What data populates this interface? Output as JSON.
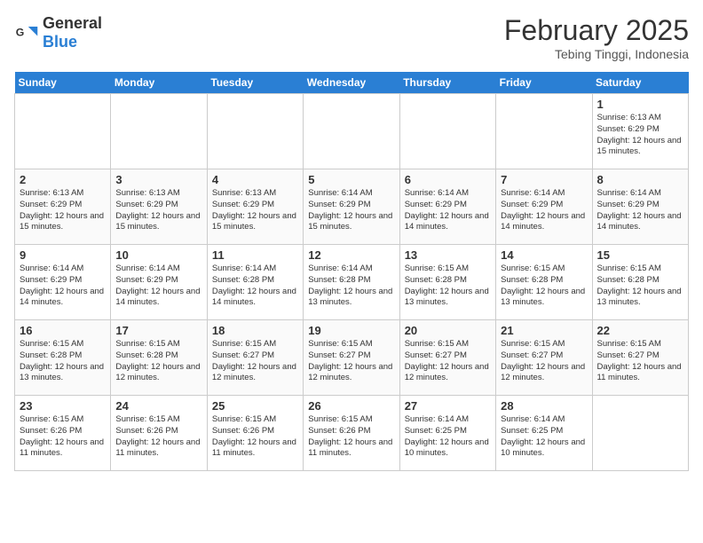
{
  "header": {
    "logo_general": "General",
    "logo_blue": "Blue",
    "month_year": "February 2025",
    "location": "Tebing Tinggi, Indonesia"
  },
  "days_of_week": [
    "Sunday",
    "Monday",
    "Tuesday",
    "Wednesday",
    "Thursday",
    "Friday",
    "Saturday"
  ],
  "weeks": [
    [
      {
        "day": "",
        "content": ""
      },
      {
        "day": "",
        "content": ""
      },
      {
        "day": "",
        "content": ""
      },
      {
        "day": "",
        "content": ""
      },
      {
        "day": "",
        "content": ""
      },
      {
        "day": "",
        "content": ""
      },
      {
        "day": "1",
        "content": "Sunrise: 6:13 AM\nSunset: 6:29 PM\nDaylight: 12 hours and 15 minutes."
      }
    ],
    [
      {
        "day": "2",
        "content": "Sunrise: 6:13 AM\nSunset: 6:29 PM\nDaylight: 12 hours and 15 minutes."
      },
      {
        "day": "3",
        "content": "Sunrise: 6:13 AM\nSunset: 6:29 PM\nDaylight: 12 hours and 15 minutes."
      },
      {
        "day": "4",
        "content": "Sunrise: 6:13 AM\nSunset: 6:29 PM\nDaylight: 12 hours and 15 minutes."
      },
      {
        "day": "5",
        "content": "Sunrise: 6:14 AM\nSunset: 6:29 PM\nDaylight: 12 hours and 15 minutes."
      },
      {
        "day": "6",
        "content": "Sunrise: 6:14 AM\nSunset: 6:29 PM\nDaylight: 12 hours and 14 minutes."
      },
      {
        "day": "7",
        "content": "Sunrise: 6:14 AM\nSunset: 6:29 PM\nDaylight: 12 hours and 14 minutes."
      },
      {
        "day": "8",
        "content": "Sunrise: 6:14 AM\nSunset: 6:29 PM\nDaylight: 12 hours and 14 minutes."
      }
    ],
    [
      {
        "day": "9",
        "content": "Sunrise: 6:14 AM\nSunset: 6:29 PM\nDaylight: 12 hours and 14 minutes."
      },
      {
        "day": "10",
        "content": "Sunrise: 6:14 AM\nSunset: 6:29 PM\nDaylight: 12 hours and 14 minutes."
      },
      {
        "day": "11",
        "content": "Sunrise: 6:14 AM\nSunset: 6:28 PM\nDaylight: 12 hours and 14 minutes."
      },
      {
        "day": "12",
        "content": "Sunrise: 6:14 AM\nSunset: 6:28 PM\nDaylight: 12 hours and 13 minutes."
      },
      {
        "day": "13",
        "content": "Sunrise: 6:15 AM\nSunset: 6:28 PM\nDaylight: 12 hours and 13 minutes."
      },
      {
        "day": "14",
        "content": "Sunrise: 6:15 AM\nSunset: 6:28 PM\nDaylight: 12 hours and 13 minutes."
      },
      {
        "day": "15",
        "content": "Sunrise: 6:15 AM\nSunset: 6:28 PM\nDaylight: 12 hours and 13 minutes."
      }
    ],
    [
      {
        "day": "16",
        "content": "Sunrise: 6:15 AM\nSunset: 6:28 PM\nDaylight: 12 hours and 13 minutes."
      },
      {
        "day": "17",
        "content": "Sunrise: 6:15 AM\nSunset: 6:28 PM\nDaylight: 12 hours and 12 minutes."
      },
      {
        "day": "18",
        "content": "Sunrise: 6:15 AM\nSunset: 6:27 PM\nDaylight: 12 hours and 12 minutes."
      },
      {
        "day": "19",
        "content": "Sunrise: 6:15 AM\nSunset: 6:27 PM\nDaylight: 12 hours and 12 minutes."
      },
      {
        "day": "20",
        "content": "Sunrise: 6:15 AM\nSunset: 6:27 PM\nDaylight: 12 hours and 12 minutes."
      },
      {
        "day": "21",
        "content": "Sunrise: 6:15 AM\nSunset: 6:27 PM\nDaylight: 12 hours and 12 minutes."
      },
      {
        "day": "22",
        "content": "Sunrise: 6:15 AM\nSunset: 6:27 PM\nDaylight: 12 hours and 11 minutes."
      }
    ],
    [
      {
        "day": "23",
        "content": "Sunrise: 6:15 AM\nSunset: 6:26 PM\nDaylight: 12 hours and 11 minutes."
      },
      {
        "day": "24",
        "content": "Sunrise: 6:15 AM\nSunset: 6:26 PM\nDaylight: 12 hours and 11 minutes."
      },
      {
        "day": "25",
        "content": "Sunrise: 6:15 AM\nSunset: 6:26 PM\nDaylight: 12 hours and 11 minutes."
      },
      {
        "day": "26",
        "content": "Sunrise: 6:15 AM\nSunset: 6:26 PM\nDaylight: 12 hours and 11 minutes."
      },
      {
        "day": "27",
        "content": "Sunrise: 6:14 AM\nSunset: 6:25 PM\nDaylight: 12 hours and 10 minutes."
      },
      {
        "day": "28",
        "content": "Sunrise: 6:14 AM\nSunset: 6:25 PM\nDaylight: 12 hours and 10 minutes."
      },
      {
        "day": "",
        "content": ""
      }
    ]
  ]
}
